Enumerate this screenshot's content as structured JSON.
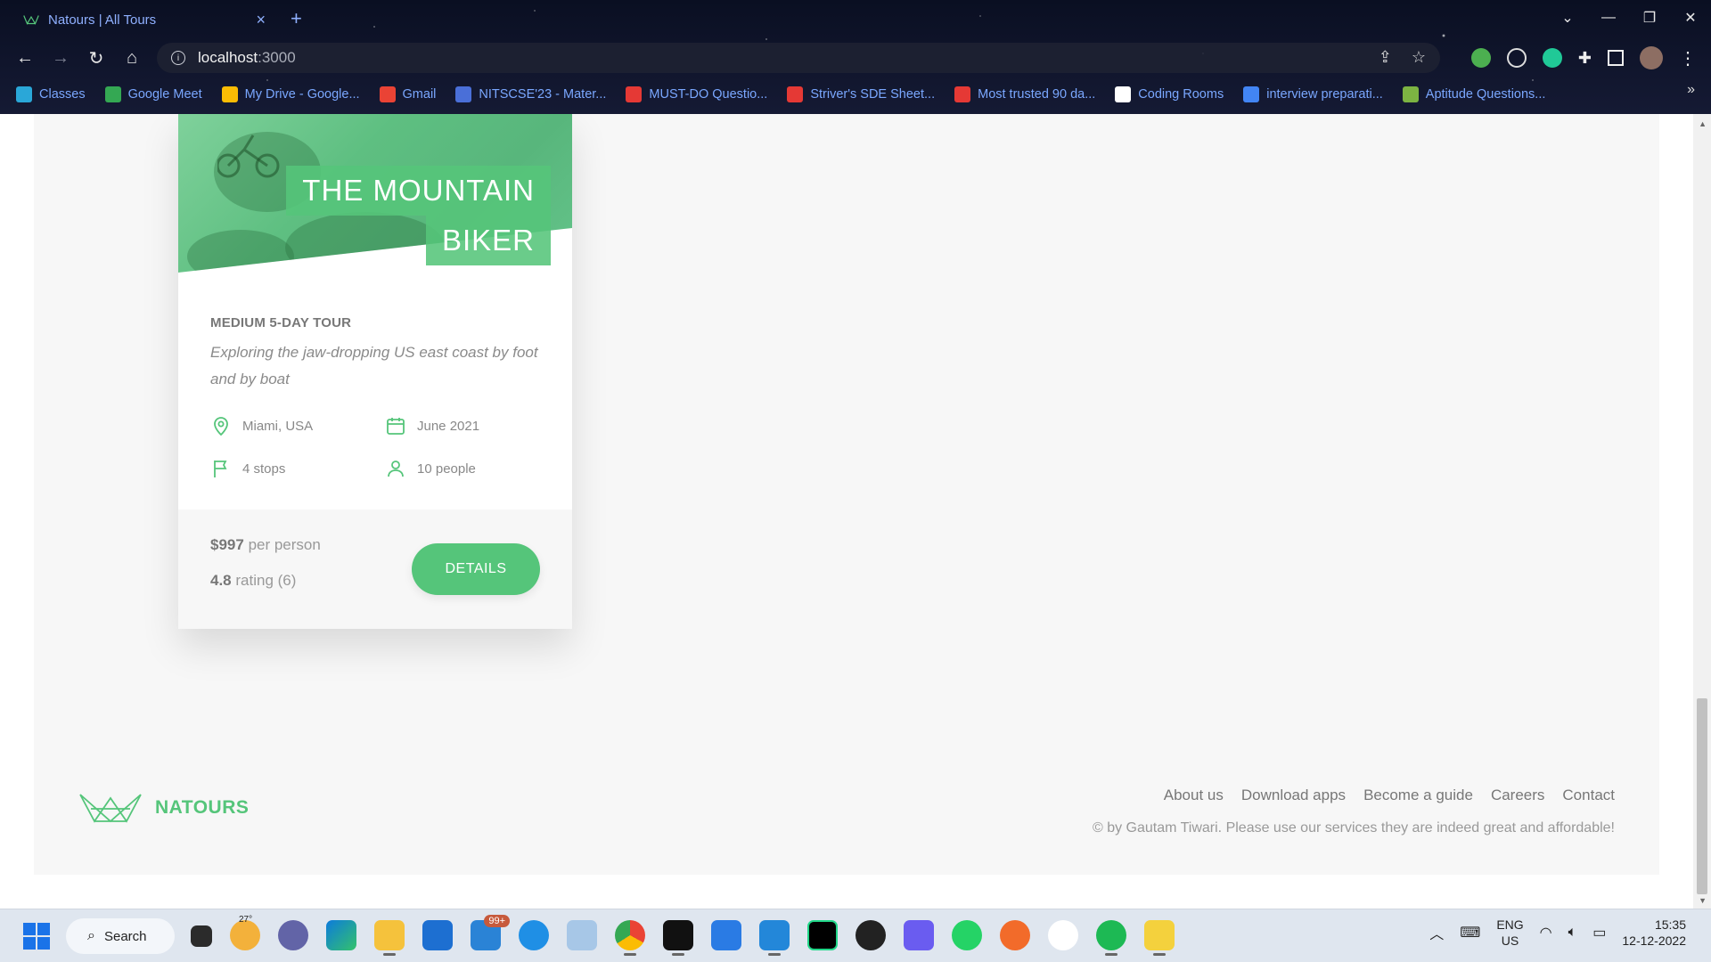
{
  "browser": {
    "tab_title": "Natours | All Tours",
    "url_host": "localhost",
    "url_port": ":3000",
    "bookmarks": [
      {
        "label": "Classes",
        "color": "#2aa7d8"
      },
      {
        "label": "Google Meet",
        "color": "#34a853"
      },
      {
        "label": "My Drive - Google...",
        "color": "#fbbc04"
      },
      {
        "label": "Gmail",
        "color": "#ea4335"
      },
      {
        "label": "NITSCSE'23 - Mater...",
        "color": "#4a6fd8"
      },
      {
        "label": "MUST-DO Questio...",
        "color": "#e53935"
      },
      {
        "label": "Striver's SDE Sheet...",
        "color": "#e53935"
      },
      {
        "label": "Most trusted 90 da...",
        "color": "#e53935"
      },
      {
        "label": "Coding Rooms",
        "color": "#ffffff"
      },
      {
        "label": "interview preparati...",
        "color": "#4285f4"
      },
      {
        "label": "Aptitude Questions...",
        "color": "#7cb342"
      }
    ]
  },
  "card": {
    "heading_line1": "THE MOUNTAIN",
    "heading_line2": "BIKER",
    "subheading": "MEDIUM 5-DAY TOUR",
    "description": "Exploring the jaw-dropping US east coast by foot and by boat",
    "location": "Miami, USA",
    "date": "June 2021",
    "stops": "4 stops",
    "people": "10 people",
    "price_value": "$997",
    "price_text": "per person",
    "rating_value": "4.8",
    "rating_text": "rating (6)",
    "details_label": "DETAILS",
    "accent": "#55c57a"
  },
  "footer": {
    "brand": "NATOURS",
    "links": [
      "About us",
      "Download apps",
      "Become a guide",
      "Careers",
      "Contact"
    ],
    "copyright": "© by Gautam Tiwari. Please use our services they are indeed great and affordable!"
  },
  "taskbar": {
    "search_label": "Search",
    "weather_temp": "27°",
    "mail_badge": "99+",
    "lang_line1": "ENG",
    "lang_line2": "US",
    "time": "15:35",
    "date": "12-12-2022"
  }
}
